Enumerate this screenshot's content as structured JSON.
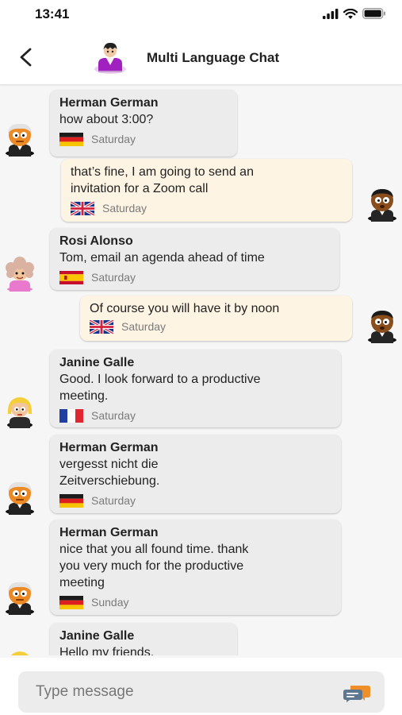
{
  "status_bar": {
    "time": "13:41"
  },
  "header": {
    "title": "Multi Language Chat"
  },
  "messages": [
    {
      "sender": "Herman German",
      "text": "how about 3:00?",
      "day": "Saturday",
      "flag": "german-flag"
    },
    {
      "text": "that’s fine, I am going to send an\ninvitation for a Zoom call",
      "day": "Saturday",
      "flag": "uk-flag"
    },
    {
      "sender": "Rosi Alonso",
      "text": "Tom, email an agenda ahead of time",
      "day": "Saturday",
      "flag": "spanish-flag"
    },
    {
      "text": "Of course you will have it by noon",
      "day": "Saturday",
      "flag": "uk-flag"
    },
    {
      "sender": "Janine Galle",
      "text": "Good. I look forward to a productive\nmeeting.",
      "day": "Saturday",
      "flag": "french-flag"
    },
    {
      "sender": "Herman German",
      "text": "vergesst nicht die\nZeitverschiebung.",
      "day": "Saturday",
      "flag": "german-flag"
    },
    {
      "sender": "Herman German",
      "text": "nice that you all found time. thank\nyou very much for the productive\nmeeting",
      "day": "Sunday",
      "flag": "german-flag"
    },
    {
      "sender": "Janine Galle",
      "text": "Hello my friends."
    }
  ],
  "composer": {
    "placeholder": "Type message"
  },
  "colors": {
    "incoming_bubble": "#ececec",
    "outgoing_bubble": "#fdf4e3",
    "header_avatar": "#a020c0"
  }
}
